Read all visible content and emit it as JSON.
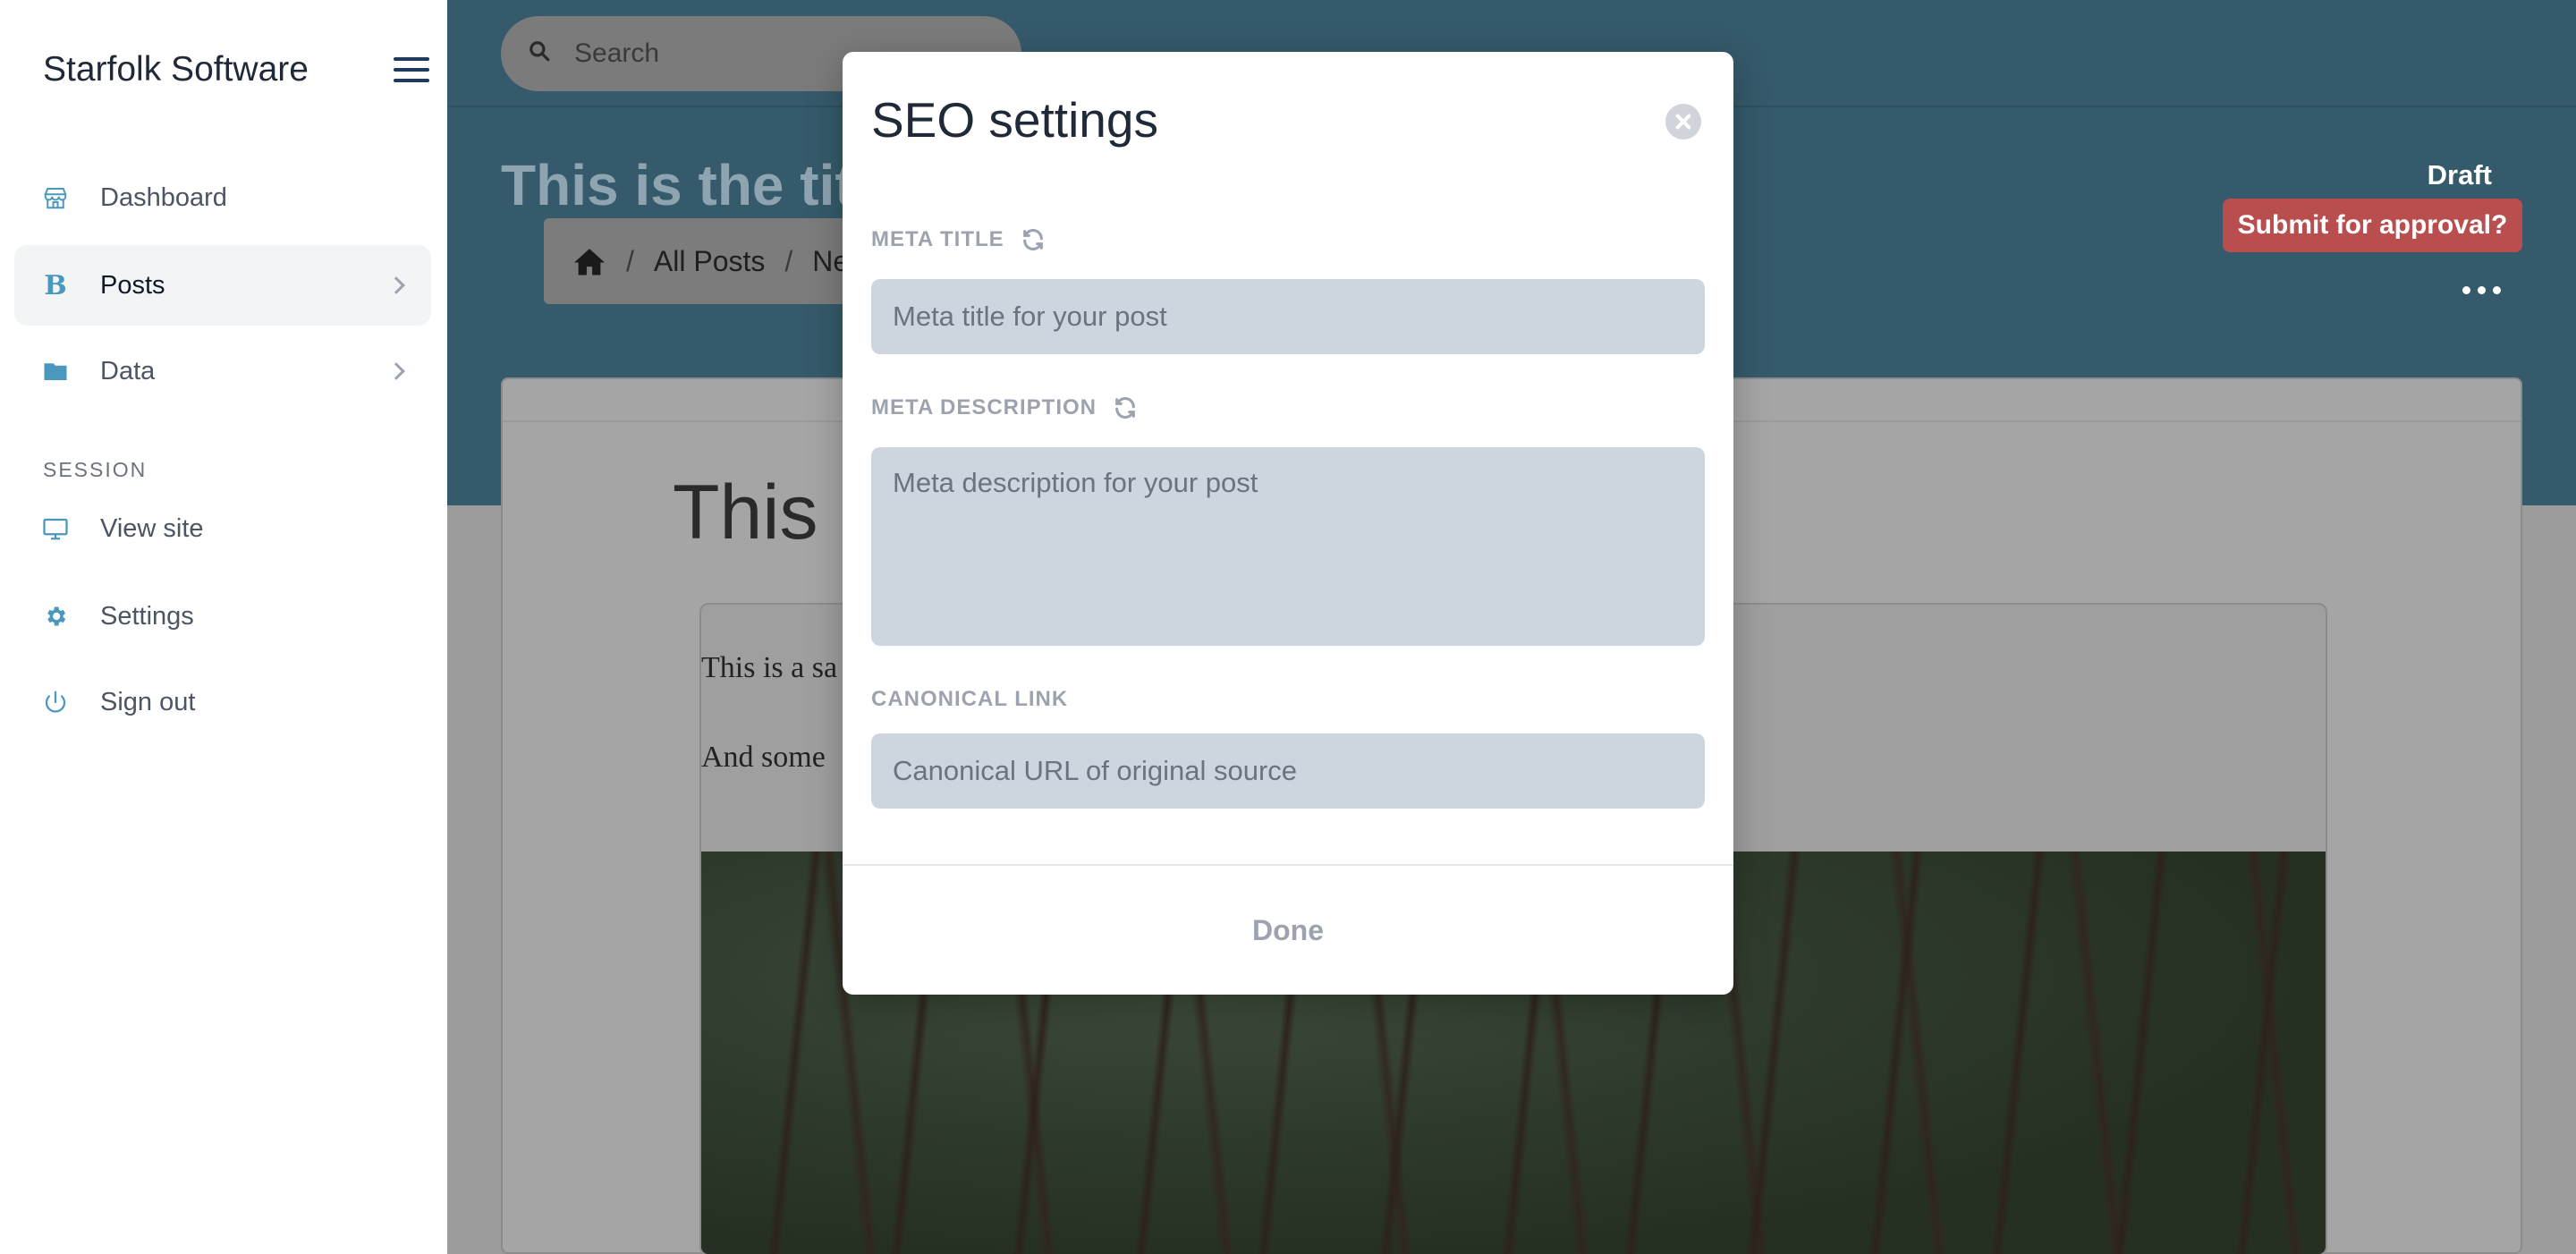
{
  "sidebar": {
    "brand": "Starfolk Software",
    "items": [
      {
        "label": "Dashboard",
        "icon": "store-icon"
      },
      {
        "label": "Posts",
        "icon": "blog-b-icon"
      },
      {
        "label": "Data",
        "icon": "folder-icon"
      }
    ],
    "section_heading": "SESSION",
    "session_items": [
      {
        "label": "View site",
        "icon": "monitor-icon"
      },
      {
        "label": "Settings",
        "icon": "gear-icon"
      },
      {
        "label": "Sign out",
        "icon": "power-icon"
      }
    ]
  },
  "header": {
    "search_placeholder": "Search",
    "page_title": "This is the title",
    "breadcrumb": [
      "All Posts",
      "Ne"
    ],
    "status": "Draft",
    "submit_label": "Submit for approval?"
  },
  "editor": {
    "title": "This i",
    "paragraph1": "This is a sa",
    "paragraph2": "And some"
  },
  "modal": {
    "title": "SEO settings",
    "meta_title_label": "META TITLE",
    "meta_title_placeholder": "Meta title for your post",
    "meta_description_label": "META DESCRIPTION",
    "meta_description_placeholder": "Meta description for your post",
    "canonical_label": "CANONICAL LINK",
    "canonical_placeholder": "Canonical URL of original source",
    "done_label": "Done"
  },
  "colors": {
    "accent": "#4a98bd",
    "hero": "#355a6b",
    "submit": "#b94e4e"
  }
}
